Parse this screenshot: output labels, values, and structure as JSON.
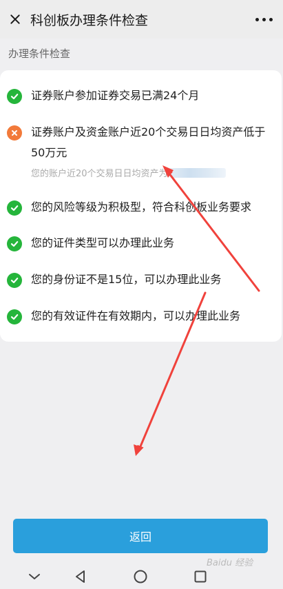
{
  "header": {
    "title": "科创板办理条件检查",
    "close_icon": "close-icon",
    "more_icon": "more-dots-icon"
  },
  "section_label": "办理条件检查",
  "conditions": [
    {
      "status": "pass",
      "text": "证券账户参加证券交易已满24个月"
    },
    {
      "status": "fail",
      "text": "证券账户及资金账户近20个交易日日均资产低于50万元",
      "detail": "您的账户近20个交易日日均资产为"
    },
    {
      "status": "pass",
      "text": "您的风险等级为积极型，符合科创板业务要求"
    },
    {
      "status": "pass",
      "text": "您的证件类型可以办理此业务"
    },
    {
      "status": "pass",
      "text": "您的身份证不是15位，可以办理此业务"
    },
    {
      "status": "pass",
      "text": "您的有效证件在有效期内，可以办理此业务"
    }
  ],
  "return_button": "返回",
  "navbar": {
    "back_icon": "chevron-down-icon",
    "triangle_icon": "back-triangle-icon",
    "home_icon": "home-circle-icon",
    "recents_icon": "recents-square-icon"
  },
  "watermark": "Baidu 经验",
  "colors": {
    "pass": "#25b53b",
    "fail": "#f27a3a",
    "primary_button": "#2a9fdc",
    "annotation_arrow": "#f0423c"
  }
}
